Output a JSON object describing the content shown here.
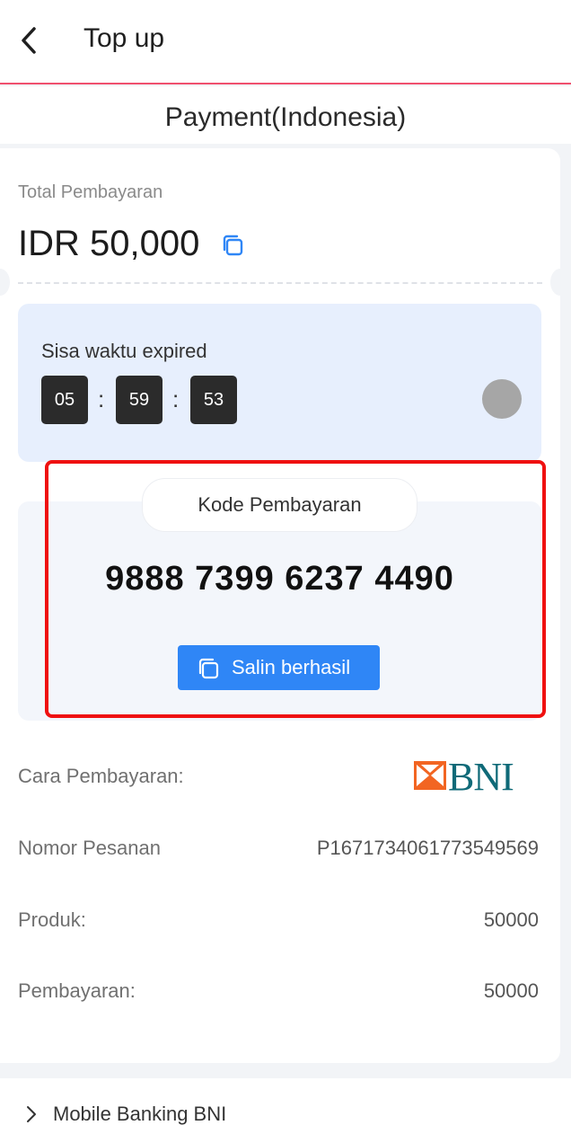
{
  "header": {
    "title": "Top up"
  },
  "page_title": "Payment(Indonesia)",
  "summary": {
    "total_label": "Total Pembayaran",
    "total_amount": "IDR 50,000"
  },
  "timer": {
    "label": "Sisa waktu expired",
    "hours": "05",
    "minutes": "59",
    "seconds": "53",
    "separator": ":"
  },
  "payment_code": {
    "label": "Kode Pembayaran",
    "code": "9888 7399 6237 4490",
    "copy_button": "Salin berhasil"
  },
  "details": {
    "method_label": "Cara Pembayaran:",
    "bank_logo_text": "BNI",
    "order_label": "Nomor Pesanan",
    "order_value": "P1671734061773549569",
    "product_label": "Produk:",
    "product_value": "50000",
    "payment_label": "Pembayaran:",
    "payment_value": "50000"
  },
  "instructions": {
    "item_label": "Mobile Banking BNI"
  },
  "colors": {
    "accent": "#2f86f6",
    "header_border": "#f0506e",
    "highlight": "#ef1010",
    "bni_teal": "#0f6a78",
    "bni_orange": "#f26522"
  }
}
